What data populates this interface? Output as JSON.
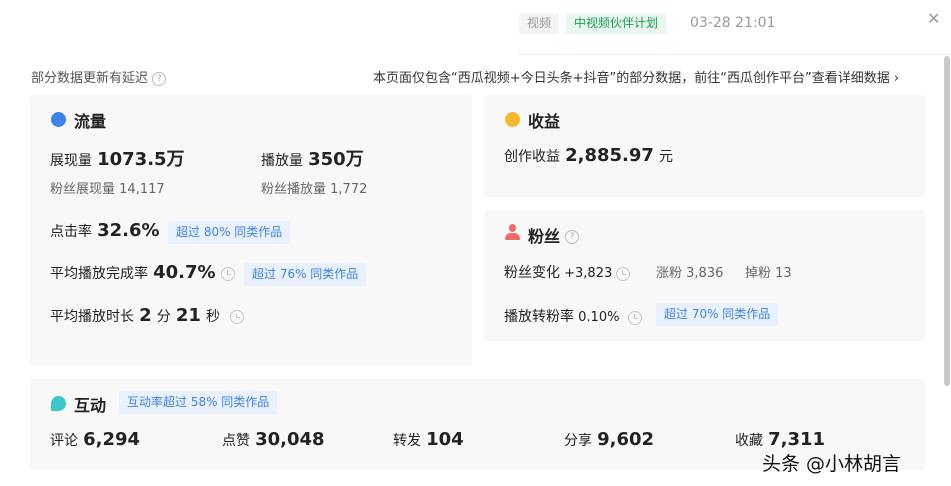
{
  "header": {
    "tag_video": "视频",
    "tag_plan": "中视频伙伴计划",
    "datetime": "03-28 21:01",
    "close": "✕"
  },
  "notice": {
    "delay": "部分数据更新有延迟",
    "scope": "本页面仅包含“西瓜视频+今日头条+抖音”的部分数据，前往“西瓜创作平台”查看详细数据",
    "arrow": "›"
  },
  "traffic": {
    "title": "流量",
    "impressions_label": "展现量",
    "impressions": "1073.5万",
    "plays_label": "播放量",
    "plays": "350万",
    "fan_impr_label": "粉丝展现量",
    "fan_impr": "14,117",
    "fan_plays_label": "粉丝播放量",
    "fan_plays": "1,772",
    "ctr_label": "点击率",
    "ctr": "32.6%",
    "ctr_badge": "超过 80% 同类作品",
    "completion_label": "平均播放完成率",
    "completion": "40.7%",
    "completion_badge": "超过 76% 同类作品",
    "duration_label": "平均播放时长",
    "dur_min": "2",
    "dur_min_unit": "分",
    "dur_sec": "21",
    "dur_sec_unit": "秒"
  },
  "revenue": {
    "title": "收益",
    "label": "创作收益",
    "value": "2,885.97",
    "unit": "元"
  },
  "fans": {
    "title": "粉丝",
    "change_label": "粉丝变化",
    "change": "+3,823",
    "gain_label": "涨粉",
    "gain": "3,836",
    "loss_label": "掉粉",
    "loss": "13",
    "conv_label": "播放转粉率",
    "conv": "0.10%",
    "conv_badge": "超过 70% 同类作品"
  },
  "interaction": {
    "title": "互动",
    "badge": "互动率超过 58% 同类作品",
    "items": [
      {
        "label": "评论",
        "value": "6,294"
      },
      {
        "label": "点赞",
        "value": "30,048"
      },
      {
        "label": "转发",
        "value": "104"
      },
      {
        "label": "分享",
        "value": "9,602"
      },
      {
        "label": "收藏",
        "value": "7,311"
      }
    ]
  },
  "watermark": "头条 @小林胡言",
  "colors": {
    "accent": "#3f83e8",
    "green": "#1a9c55",
    "revenue": "#f5b82e",
    "fans": "#f06a6a",
    "interaction": "#3cc7c7"
  }
}
